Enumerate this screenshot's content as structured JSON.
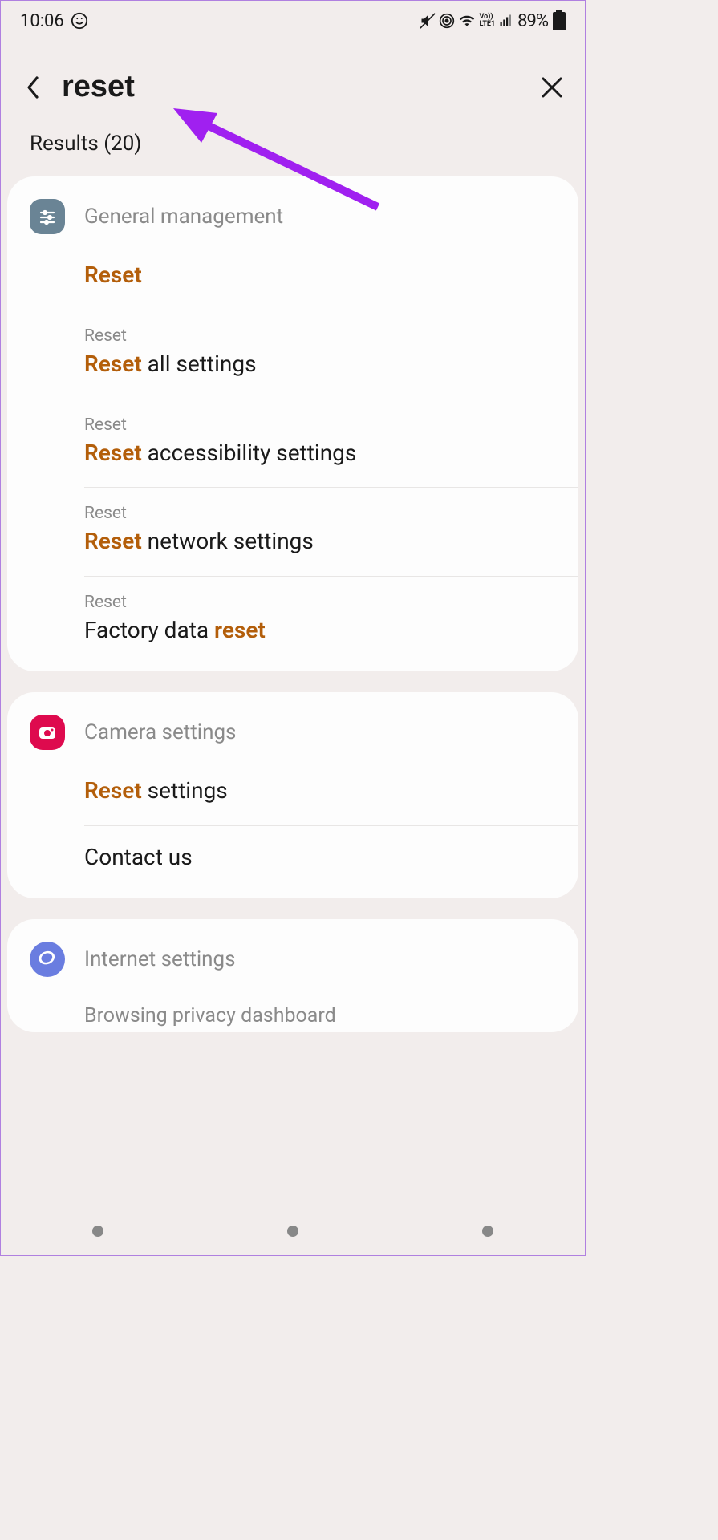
{
  "status": {
    "time": "10:06",
    "battery_pct": "89%",
    "volte": "Vo))\nLTE1"
  },
  "search": {
    "query": "reset",
    "results_label": "Results (20)"
  },
  "sections": [
    {
      "icon": "sliders-icon",
      "title": "General management",
      "items": [
        {
          "crumb": "",
          "title_parts": [
            {
              "t": "Reset",
              "hl": true
            }
          ]
        },
        {
          "crumb": "Reset",
          "title_parts": [
            {
              "t": "Reset",
              "hl": true
            },
            {
              "t": " all settings",
              "hl": false
            }
          ]
        },
        {
          "crumb": "Reset",
          "title_parts": [
            {
              "t": "Reset",
              "hl": true
            },
            {
              "t": " accessibility settings",
              "hl": false
            }
          ]
        },
        {
          "crumb": "Reset",
          "title_parts": [
            {
              "t": "Reset",
              "hl": true
            },
            {
              "t": " network settings",
              "hl": false
            }
          ]
        },
        {
          "crumb": "Reset",
          "title_parts": [
            {
              "t": "Factory data ",
              "hl": false
            },
            {
              "t": "reset",
              "hl": true
            }
          ]
        }
      ]
    },
    {
      "icon": "camera-icon",
      "title": "Camera settings",
      "items": [
        {
          "crumb": "",
          "title_parts": [
            {
              "t": "Reset",
              "hl": true
            },
            {
              "t": " settings",
              "hl": false
            }
          ]
        },
        {
          "crumb": "",
          "title_parts": [
            {
              "t": "Contact us",
              "hl": false
            }
          ]
        }
      ]
    },
    {
      "icon": "globe-icon",
      "title": "Internet settings",
      "items": [
        {
          "crumb": "",
          "title_parts": [
            {
              "t": "Browsing privacy dashboard",
              "hl": false
            }
          ]
        }
      ]
    }
  ]
}
